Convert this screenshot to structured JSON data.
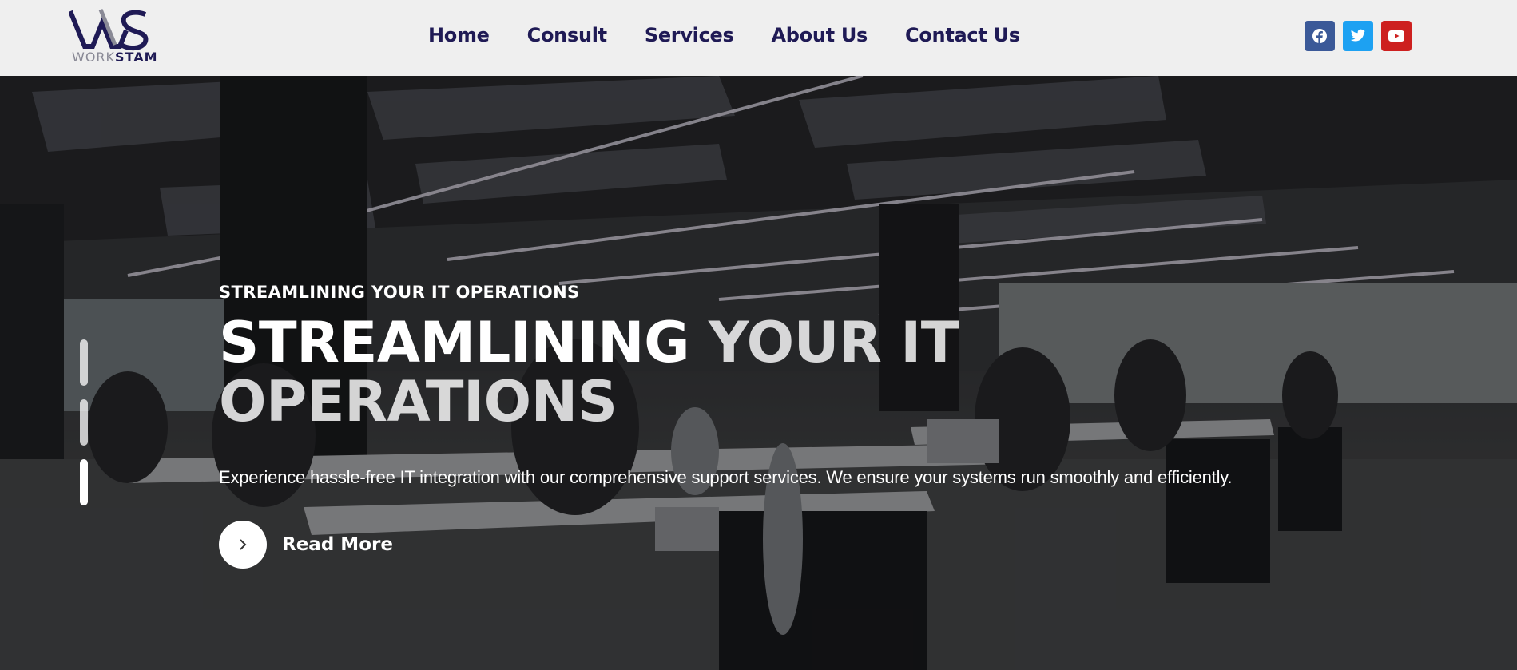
{
  "brand": {
    "name_part1": "WORK",
    "name_part2": "STAM",
    "colors": {
      "primary": "#1f1a55",
      "secondary": "#8a8a96"
    }
  },
  "nav": {
    "items": [
      {
        "label": "Home"
      },
      {
        "label": "Consult"
      },
      {
        "label": "Services"
      },
      {
        "label": "About Us"
      },
      {
        "label": "Contact Us"
      }
    ]
  },
  "social": [
    {
      "icon": "facebook-icon",
      "color": "#3b5998"
    },
    {
      "icon": "twitter-icon",
      "color": "#1da1f2"
    },
    {
      "icon": "youtube-icon",
      "color": "#cd201f"
    }
  ],
  "hero": {
    "eyebrow": "STREAMLINING YOUR IT OPERATIONS",
    "headline_strong": "STREAMLINING",
    "headline_rest": "YOUR IT OPERATIONS",
    "description": "Experience hassle-free IT integration with our comprehensive support services. We ensure your systems run smoothly and efficiently.",
    "cta_label": "Read More",
    "slides_count": 3,
    "active_slide": 3
  }
}
